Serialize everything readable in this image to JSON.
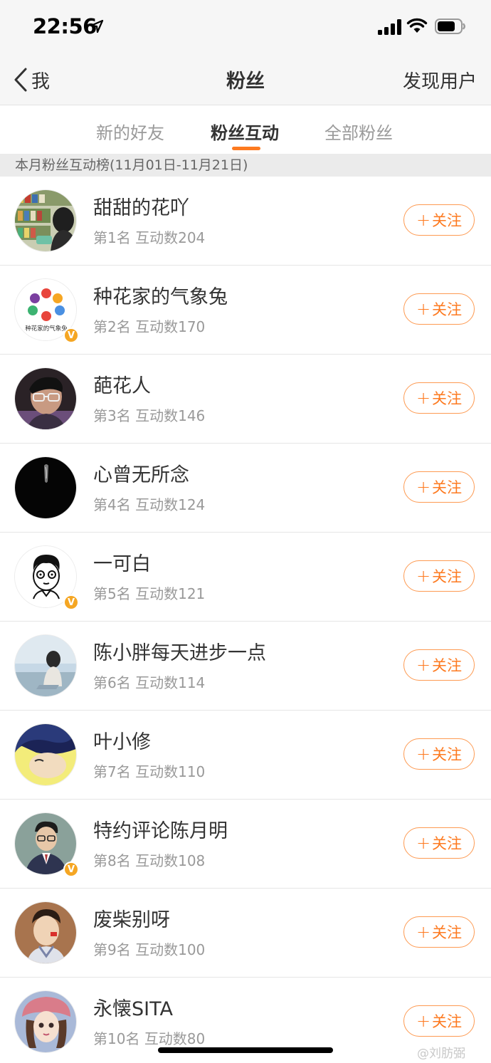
{
  "status_bar": {
    "time": "22:56",
    "icons": [
      "location-arrow-icon",
      "cellular-signal-icon",
      "wifi-icon",
      "battery-icon"
    ]
  },
  "navbar": {
    "back_label": "我",
    "title": "粉丝",
    "right_action": "发现用户"
  },
  "tabs": [
    {
      "label": "新的好友",
      "active": false
    },
    {
      "label": "粉丝互动",
      "active": true
    },
    {
      "label": "全部粉丝",
      "active": false
    }
  ],
  "section_header": "本月粉丝互动榜(11月01日-11月21日)",
  "follow_button": {
    "plus": "+",
    "label": "关注"
  },
  "accent_color": "#fd7a20",
  "verified_badge": "V",
  "fans": [
    {
      "name": "甜甜的花吖",
      "rank": "第1名",
      "interactions": "互动数204",
      "verified": false
    },
    {
      "name": "种花家的气象兔",
      "rank": "第2名",
      "interactions": "互动数170",
      "verified": true,
      "logo_text": "种花家的气象兔"
    },
    {
      "name": "葩花人",
      "rank": "第3名",
      "interactions": "互动数146",
      "verified": false
    },
    {
      "name": "心曾无所念",
      "rank": "第4名",
      "interactions": "互动数124",
      "verified": false
    },
    {
      "name": "一可白",
      "rank": "第5名",
      "interactions": "互动数121",
      "verified": true
    },
    {
      "name": "陈小胖每天进步一点",
      "rank": "第6名",
      "interactions": "互动数114",
      "verified": false
    },
    {
      "name": "叶小修",
      "rank": "第7名",
      "interactions": "互动数110",
      "verified": false
    },
    {
      "name": "特约评论陈月明",
      "rank": "第8名",
      "interactions": "互动数108",
      "verified": true
    },
    {
      "name": "废柴别呀",
      "rank": "第9名",
      "interactions": "互动数100",
      "verified": false
    },
    {
      "name": "永懐SITA",
      "rank": "第10名",
      "interactions": "互动数80",
      "verified": false
    }
  ],
  "watermark": "@刘肪弼"
}
